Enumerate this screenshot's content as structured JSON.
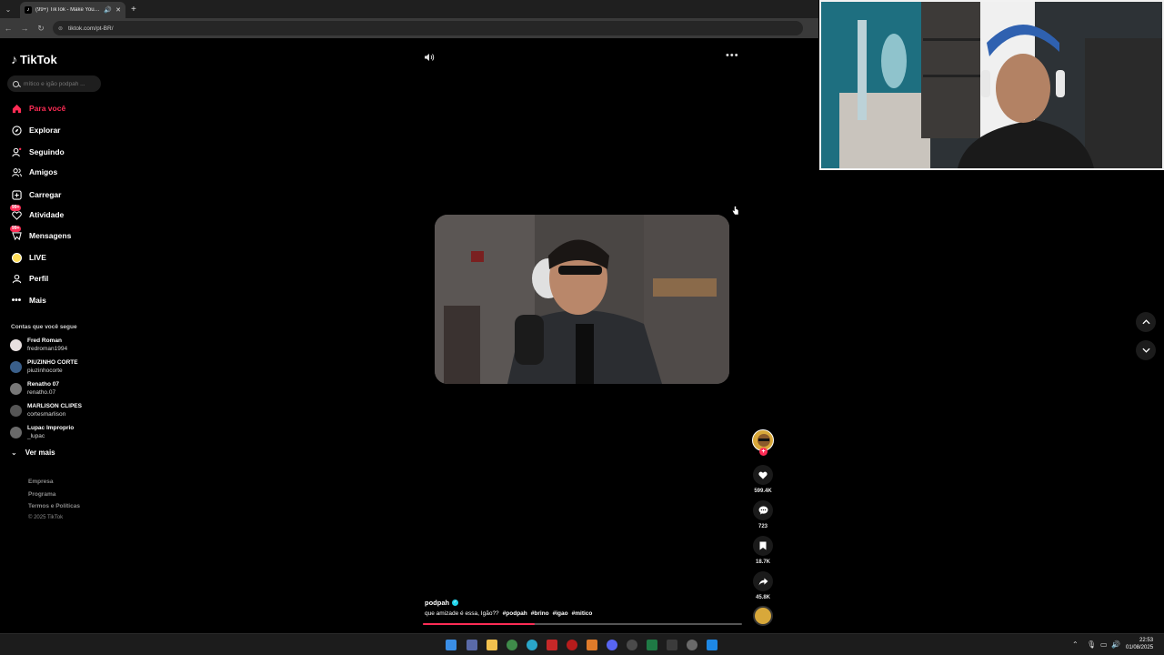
{
  "browser": {
    "tab_title": "(99+) TikTok - Make Your Day",
    "url": "tiktok.com/pt-BR/"
  },
  "sidebar": {
    "logo": "TikTok",
    "search_placeholder": "mítico e igão podpah ...",
    "nav": [
      {
        "label": "Para você",
        "icon": "home-icon"
      },
      {
        "label": "Explorar",
        "icon": "compass-icon"
      },
      {
        "label": "Seguindo",
        "icon": "following-icon"
      },
      {
        "label": "Amigos",
        "icon": "friends-icon"
      },
      {
        "label": "Carregar",
        "icon": "upload-icon"
      },
      {
        "label": "Atividade",
        "icon": "activity-icon",
        "badge": "99+"
      },
      {
        "label": "Mensagens",
        "icon": "messages-icon",
        "badge": "99+"
      },
      {
        "label": "LIVE",
        "icon": "live-icon"
      },
      {
        "label": "Perfil",
        "icon": "profile-icon"
      },
      {
        "label": "Mais",
        "icon": "more-icon"
      }
    ],
    "following_title": "Contas que você segue",
    "accounts": [
      {
        "name": "Fred Roman",
        "handle": "fredroman1994",
        "color": "#e8e0e0"
      },
      {
        "name": "PIUZINHO CORTE",
        "handle": "piuzinhocorte",
        "color": "#3a5f8a"
      },
      {
        "name": "Renatho 07",
        "handle": "renatho.07",
        "color": "#777"
      },
      {
        "name": "MARLISON CLIPES",
        "handle": "cortesmarlison",
        "color": "#555"
      },
      {
        "name": "Lupac Improprio",
        "handle": "_lupac",
        "color": "#6a6a6a"
      }
    ],
    "see_more": "Ver mais",
    "footer": [
      "Empresa",
      "Programa",
      "Termos e Políticas",
      "© 2025 TikTok"
    ]
  },
  "video": {
    "author": "podpah",
    "caption": "que amizade é essa, Igão??",
    "hashtags": [
      "#podpah",
      "#brino",
      "#igao",
      "#mitico"
    ],
    "progress": 0.35,
    "likes": "599.4K",
    "comments": "723",
    "saves": "18.7K",
    "shares": "45.8K"
  },
  "taskbar": {
    "time": "22:53",
    "date": "01/08/2025"
  },
  "colors": {
    "accent": "#fe2c55",
    "background": "#000000"
  }
}
